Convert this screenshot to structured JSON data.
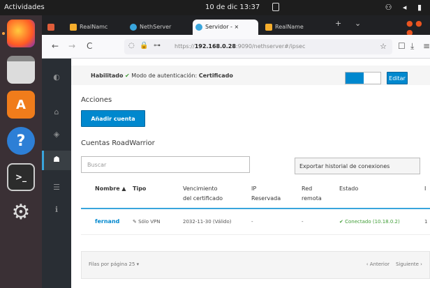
{
  "topbar": {
    "activities": "Actividades",
    "clock": "10 de dic 13:37",
    "sys_icons": "⚇ ◂ ▮"
  },
  "dock": {
    "items": [
      "firefox",
      "files",
      "software",
      "help",
      "terminal",
      "settings"
    ]
  },
  "browser": {
    "tabs": [
      {
        "label": "RealNamc",
        "color": "#f6ae2d"
      },
      {
        "label": "NethServer",
        "color": "#39a5dc"
      },
      {
        "label": "Servidor - ×",
        "color": "#39a5dc"
      },
      {
        "label": "RealName",
        "color": "#f6ae2d"
      }
    ],
    "new_tab": "+",
    "tab_list": "⌄",
    "url_prefix": "https://",
    "url_host": "192.168.0.28",
    "url_path": ":9090/nethserver#/ipsec",
    "back": "←",
    "forward": "→",
    "reload": "C",
    "star": "☆",
    "shield": "☐",
    "download": "⤓",
    "menu": "≡"
  },
  "cert": {
    "enabled_label": "Habilitado",
    "check": "✔",
    "mode_label": "Modo de autenticación:",
    "mode_value": "Certificado",
    "edit": "Editar"
  },
  "actions": {
    "title": "Acciones",
    "add_account": "Añadir cuenta"
  },
  "accounts": {
    "title": "Cuentas RoadWarrior",
    "search_placeholder": "Buscar",
    "export": "Exportar historial de conexiones",
    "columns": {
      "name": "Nombre ▲",
      "type": "Tipo",
      "expiry_1": "Vencimiento",
      "expiry_2": "del certificado",
      "ip_1": "IP",
      "ip_2": "Reservada",
      "remote_1": "Red",
      "remote_2": "remota",
      "state": "Estado",
      "extra": "I"
    },
    "rows": [
      {
        "name": "fernand",
        "type": "✎ Sólo VPN",
        "expiry": "2032-11-30 (Válido)",
        "ip": "-",
        "remote": "-",
        "state": "✔ Conectado (10.18.0.2)",
        "extra": "1"
      }
    ]
  },
  "pager": {
    "per_page_label": "Filas por página",
    "per_page_value": "25 ▾",
    "prev": "‹ Anterior",
    "next": "Siguiente ›"
  }
}
